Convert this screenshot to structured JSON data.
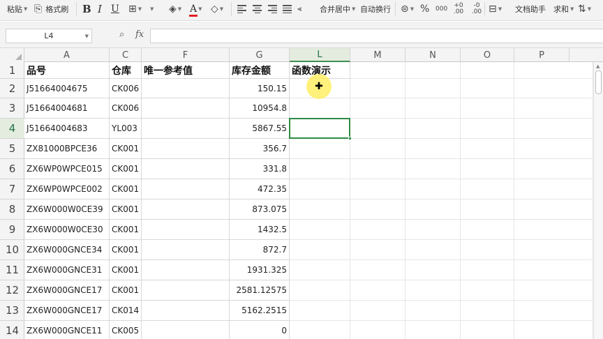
{
  "ribbon": {
    "paste_label": "粘贴",
    "format_painter_label": "格式刷",
    "bold_glyph": "B",
    "italic_glyph": "I",
    "underline_glyph": "U",
    "font_color_glyph": "A",
    "merge_center_label": "合并居中",
    "wrap_text_label": "自动换行",
    "percent_glyph": "%",
    "thousands_glyph": "000",
    "inc_decimal_glyph": "+0 .00",
    "dec_decimal_glyph": "-0 .00",
    "doc_assistant_label": "文档助手",
    "sum_label": "求和",
    "font_color": "#e02020"
  },
  "formula_bar": {
    "name_box": "L4",
    "fx_label": "fx",
    "formula": ""
  },
  "columns": [
    "A",
    "C",
    "F",
    "G",
    "L",
    "M",
    "N",
    "O",
    "P"
  ],
  "selected_column": "L",
  "rows": [
    "1",
    "2",
    "3",
    "4",
    "5",
    "6",
    "7",
    "8",
    "9",
    "10",
    "11",
    "12",
    "13",
    "14"
  ],
  "selected_row": "4",
  "headers": {
    "part_no": "品号",
    "warehouse": "仓库",
    "unique_ref": "唯一参考值",
    "stock_amount": "库存金额",
    "function_demo": "函数演示"
  },
  "data_rows": [
    {
      "part_no": "J51664004675",
      "warehouse": "CK006",
      "unique_ref": "",
      "amount": "150.15"
    },
    {
      "part_no": "J51664004681",
      "warehouse": "CK006",
      "unique_ref": "",
      "amount": "10954.8"
    },
    {
      "part_no": "J51664004683",
      "warehouse": "YL003",
      "unique_ref": "",
      "amount": "5867.55"
    },
    {
      "part_no": "ZX81000BPCE36",
      "warehouse": "CK001",
      "unique_ref": "",
      "amount": "356.7"
    },
    {
      "part_no": "ZX6WP0WPCE015",
      "warehouse": "CK001",
      "unique_ref": "",
      "amount": "331.8"
    },
    {
      "part_no": "ZX6WP0WPCE002",
      "warehouse": "CK001",
      "unique_ref": "",
      "amount": "472.35"
    },
    {
      "part_no": "ZX6W000W0CE39",
      "warehouse": "CK001",
      "unique_ref": "",
      "amount": "873.075"
    },
    {
      "part_no": "ZX6W000W0CE30",
      "warehouse": "CK001",
      "unique_ref": "",
      "amount": "1432.5"
    },
    {
      "part_no": "ZX6W000GNCE34",
      "warehouse": "CK001",
      "unique_ref": "",
      "amount": "872.7"
    },
    {
      "part_no": "ZX6W000GNCE31",
      "warehouse": "CK001",
      "unique_ref": "",
      "amount": "1931.325"
    },
    {
      "part_no": "ZX6W000GNCE17",
      "warehouse": "CK001",
      "unique_ref": "",
      "amount": "2581.12575"
    },
    {
      "part_no": "ZX6W000GNCE17",
      "warehouse": "CK014",
      "unique_ref": "",
      "amount": "5162.2515"
    },
    {
      "part_no": "ZX6W000GNCE11",
      "warehouse": "CK005",
      "unique_ref": "",
      "amount": "0"
    }
  ],
  "colors": {
    "selection": "#2e8b45",
    "header_selected_bg": "#e4ecdf",
    "cursor_highlight": "#ffec50"
  }
}
